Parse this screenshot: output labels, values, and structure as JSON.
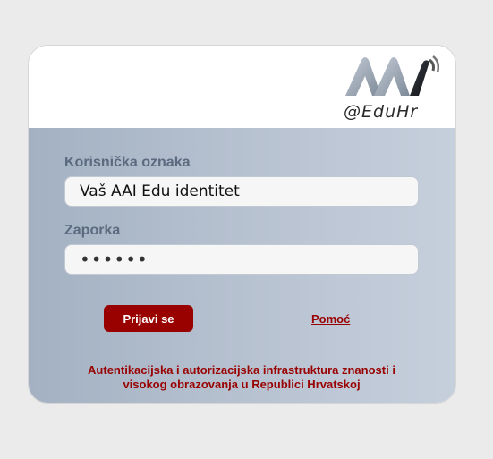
{
  "logo": {
    "text": "AAI@EduHr",
    "caption": "@EduHr"
  },
  "form": {
    "username_label": "Korisnička oznaka",
    "username_value": "Vaš AAI Edu identitet",
    "password_label": "Zaporka",
    "password_value": "••••••"
  },
  "actions": {
    "login_label": "Prijavi se",
    "help_label": "Pomoć"
  },
  "footer": {
    "line1": "Autentikacijska i autorizacijska infrastruktura znanosti i",
    "line2": "visokog obrazovanja u Republici Hrvatskoj"
  },
  "colors": {
    "accent": "#990000",
    "label": "#5b6a7f",
    "page_background": "#ebebeb"
  },
  "icons": {
    "logo": "aai-eduhr-logo"
  }
}
